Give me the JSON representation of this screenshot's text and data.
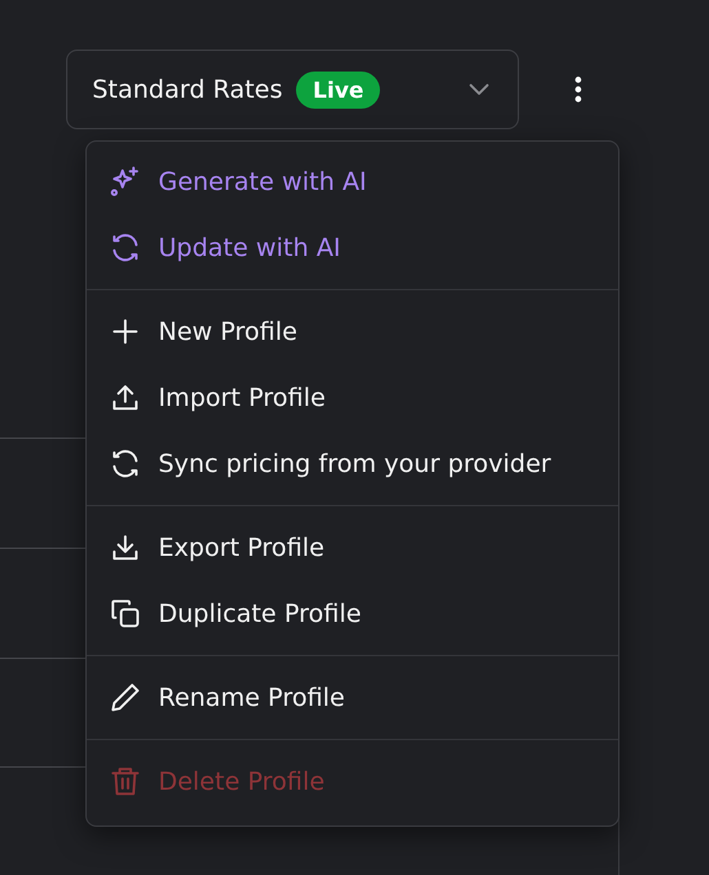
{
  "profile_select": {
    "value": "Standard Rates",
    "badge": "Live"
  },
  "menu": {
    "groups": [
      {
        "items": [
          {
            "label": "Generate with AI",
            "kind": "ai"
          },
          {
            "label": "Update with AI",
            "kind": "ai"
          }
        ]
      },
      {
        "items": [
          {
            "label": "New Profile",
            "kind": "normal"
          },
          {
            "label": "Import Profile",
            "kind": "normal"
          },
          {
            "label": "Sync pricing from your provider",
            "kind": "normal"
          }
        ]
      },
      {
        "items": [
          {
            "label": "Export Profile",
            "kind": "normal"
          },
          {
            "label": "Duplicate Profile",
            "kind": "normal"
          }
        ]
      },
      {
        "items": [
          {
            "label": "Rename Profile",
            "kind": "normal"
          }
        ]
      },
      {
        "items": [
          {
            "label": "Delete Profile",
            "kind": "danger"
          }
        ]
      }
    ]
  }
}
